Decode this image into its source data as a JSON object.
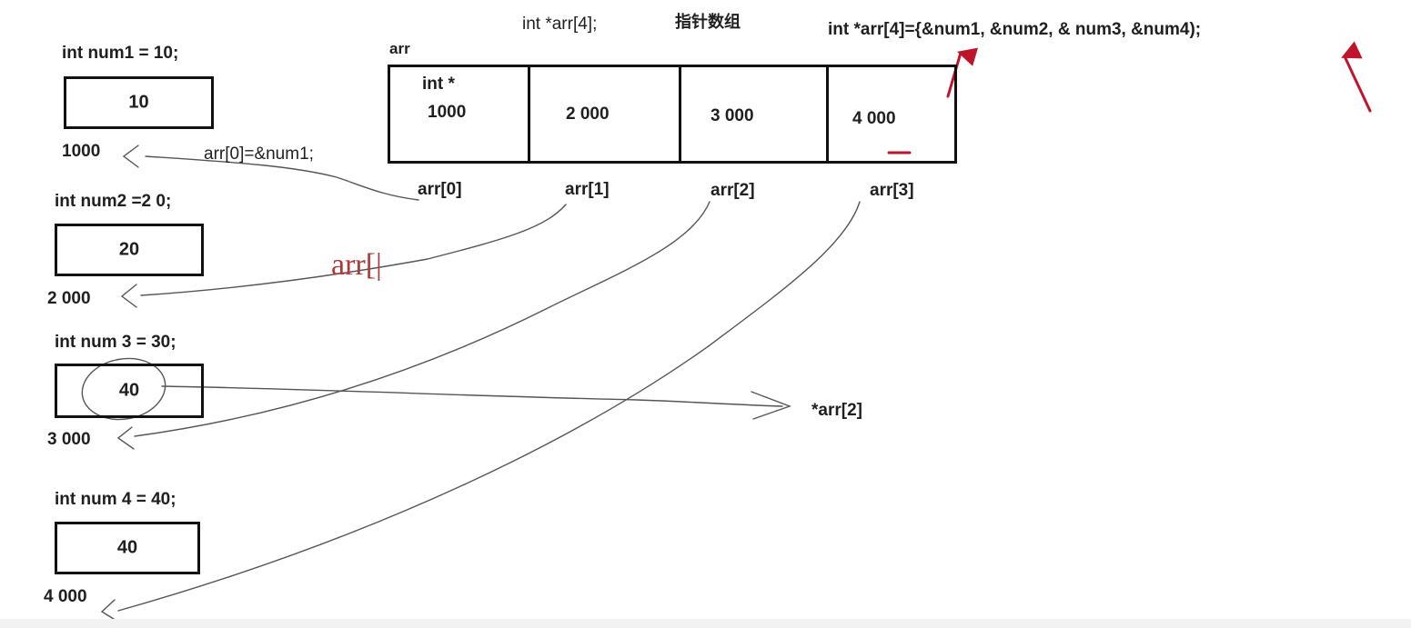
{
  "header": {
    "declaration": "int *arr[4];",
    "caption": "指针数组",
    "initializer": "int *arr[4]={&num1, &num2, & num3, &num4);"
  },
  "array": {
    "name": "arr",
    "type_label": "int *",
    "cells": [
      "1000",
      "2 000",
      "3 000",
      "4 000"
    ],
    "indices": [
      "arr[0]",
      "arr[1]",
      "arr[2]",
      "arr[3]"
    ]
  },
  "variables": [
    {
      "declaration": "int num1 = 10;",
      "value": "10",
      "address": "1000"
    },
    {
      "declaration": "int num2 =2 0;",
      "value": "20",
      "address": "2 000"
    },
    {
      "declaration": "int num 3 = 30;",
      "value": "40",
      "address": "3 000"
    },
    {
      "declaration": "int num 4 = 40;",
      "value": "40",
      "address": "4 000"
    }
  ],
  "assignment": "arr[0]=&num1;",
  "deref_label": "*arr[2]",
  "handwritten": "arr[|",
  "colors": {
    "ink": "#1f1f1f",
    "pen": "#555555",
    "accent": "#c0142c"
  }
}
